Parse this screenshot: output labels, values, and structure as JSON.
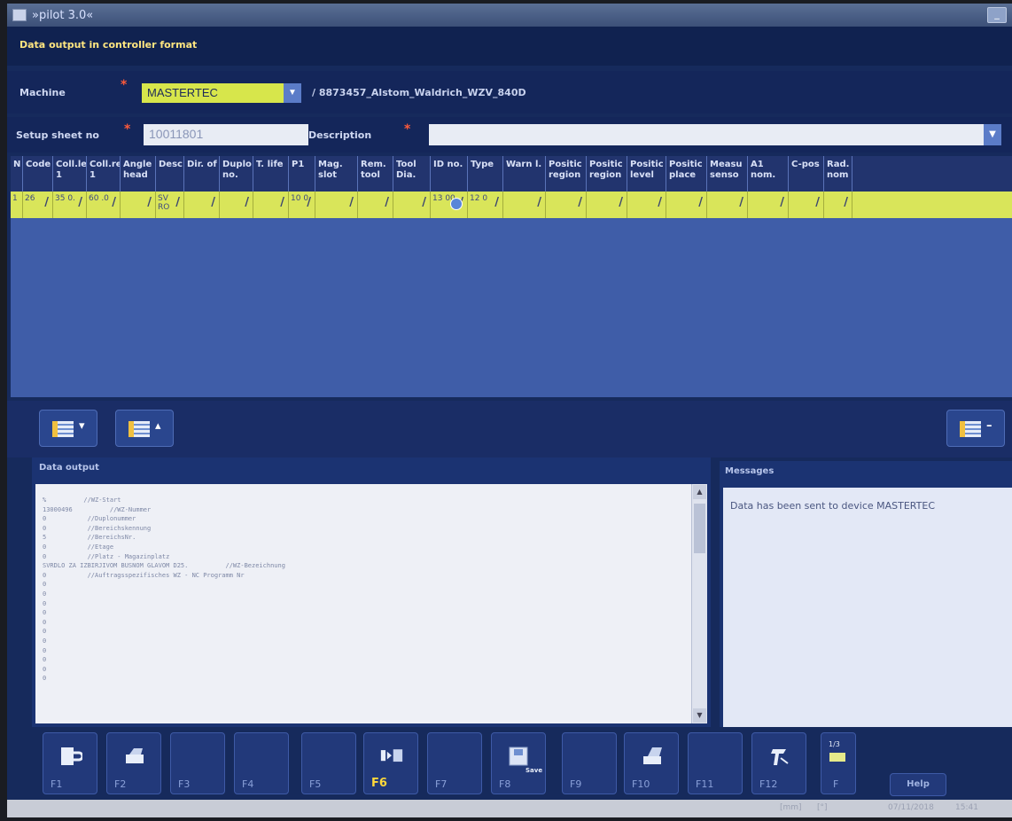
{
  "window": {
    "title": "»pilot 3.0«"
  },
  "header": {
    "title": "Data output in controller format"
  },
  "machine": {
    "label": "Machine",
    "value": "MASTERTEC",
    "path": "/ 8873457_Alstom_Waldrich_WZV_840D"
  },
  "setup": {
    "label": "Setup sheet no",
    "value": "10011801",
    "desc_label": "Description",
    "desc_value": ""
  },
  "table": {
    "headers": [
      "N",
      "Code",
      "Coll.le 1",
      "Coll.re 1",
      "Angle head",
      "Desc.",
      "Dir. of",
      "Duplo no.",
      "T. life",
      "P1",
      "Mag. slot",
      "Rem. tool",
      "Tool Dia.",
      "ID no.",
      "Type",
      "Warn l.",
      "Positic region",
      "Positic region",
      "Positic level",
      "Positic place",
      "Measu senso",
      "A1 nom.",
      "C-pos",
      "Rad. nom"
    ],
    "row": [
      "1",
      "26",
      "35 0.",
      "60 .0",
      "",
      "SV RO",
      "",
      "",
      "",
      "10 0",
      "",
      "",
      "",
      "13 00",
      "12 0",
      "",
      "",
      "",
      "",
      "",
      "",
      "",
      "",
      ""
    ]
  },
  "data_output": {
    "title": "Data output",
    "lines": [
      "%          //WZ-Start",
      "13000496          //WZ-Nummer",
      "0           //Duplonummer",
      "0           //Bereichskennung",
      "5           //BereichsNr.",
      "0           //Etage",
      "0           //Platz - Magazinplatz",
      "SVRDLO ZA IZBIRJIVOM BUSNOM GLAVOM D25.          //WZ-Bezeichnung",
      "0           //Auftragsspezifisches WZ - NC Programm Nr",
      "0",
      "0",
      "0",
      "0",
      "0",
      "0",
      "0",
      "0",
      "0",
      "0",
      "0"
    ]
  },
  "messages": {
    "title": "Messages",
    "text": "Data has been sent to device MASTERTEC"
  },
  "fkeys": [
    "F1",
    "F2",
    "F3",
    "F4",
    "F5",
    "F6",
    "F7",
    "F8",
    "F9",
    "F10",
    "F11",
    "F12",
    "F"
  ],
  "fkey_extra": {
    "save": "Save",
    "page": "1/3",
    "help": "Help"
  },
  "status": {
    "unit": "[mm]",
    "unit2": "[°]",
    "date": "07/11/2018",
    "time": "15:41"
  },
  "colors": {
    "accent_yellow": "#d9e55a",
    "background": "#162a5c"
  }
}
